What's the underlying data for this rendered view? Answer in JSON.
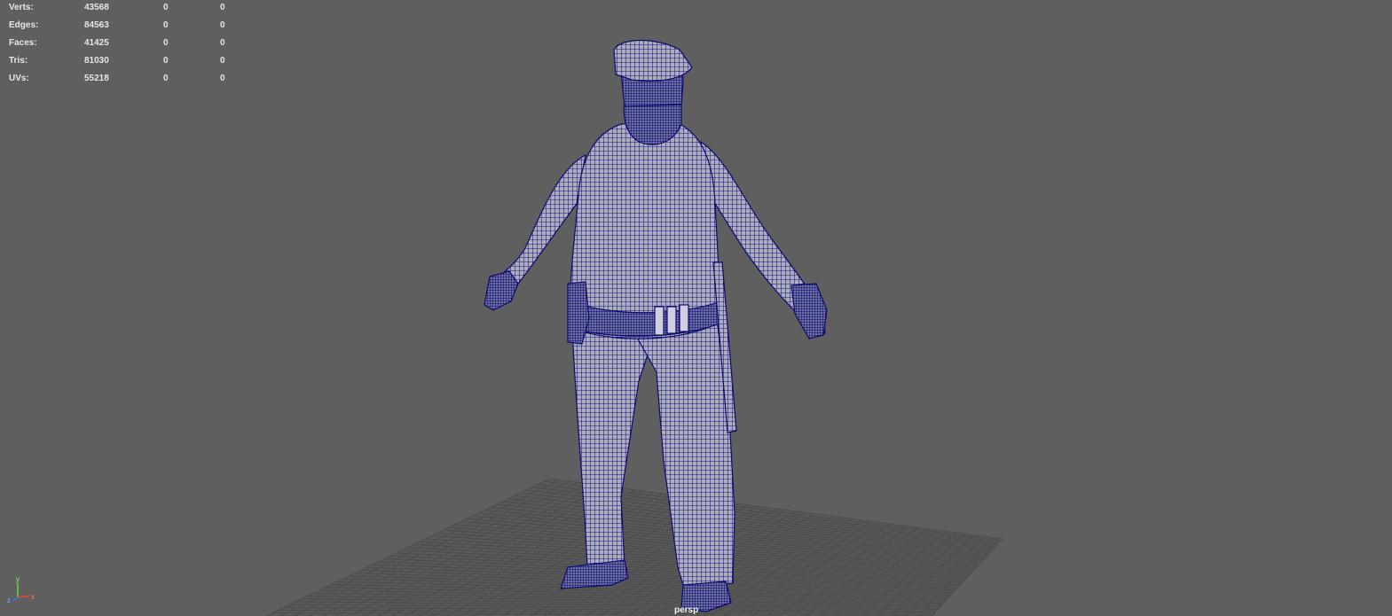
{
  "hud": {
    "rows": [
      {
        "label": "Verts:",
        "total": "43568",
        "selected": "0",
        "component": "0"
      },
      {
        "label": "Edges:",
        "total": "84563",
        "selected": "0",
        "component": "0"
      },
      {
        "label": "Faces:",
        "total": "41425",
        "selected": "0",
        "component": "0"
      },
      {
        "label": "Tris:",
        "total": "81030",
        "selected": "0",
        "component": "0"
      },
      {
        "label": "UVs:",
        "total": "55218",
        "selected": "0",
        "component": "0"
      }
    ]
  },
  "viewport": {
    "camera": "persp",
    "background_color": "#5f5f5f",
    "grid_color": "#4a4a4a",
    "wireframe_color": "#0e0e82",
    "mesh_fill_color": "#a9a9b6"
  },
  "axis_gizmo": {
    "x_label": "x",
    "y_label": "y",
    "z_label": "z",
    "x_color": "#e0463c",
    "y_color": "#6ad43a",
    "z_color": "#3c7ae0"
  }
}
